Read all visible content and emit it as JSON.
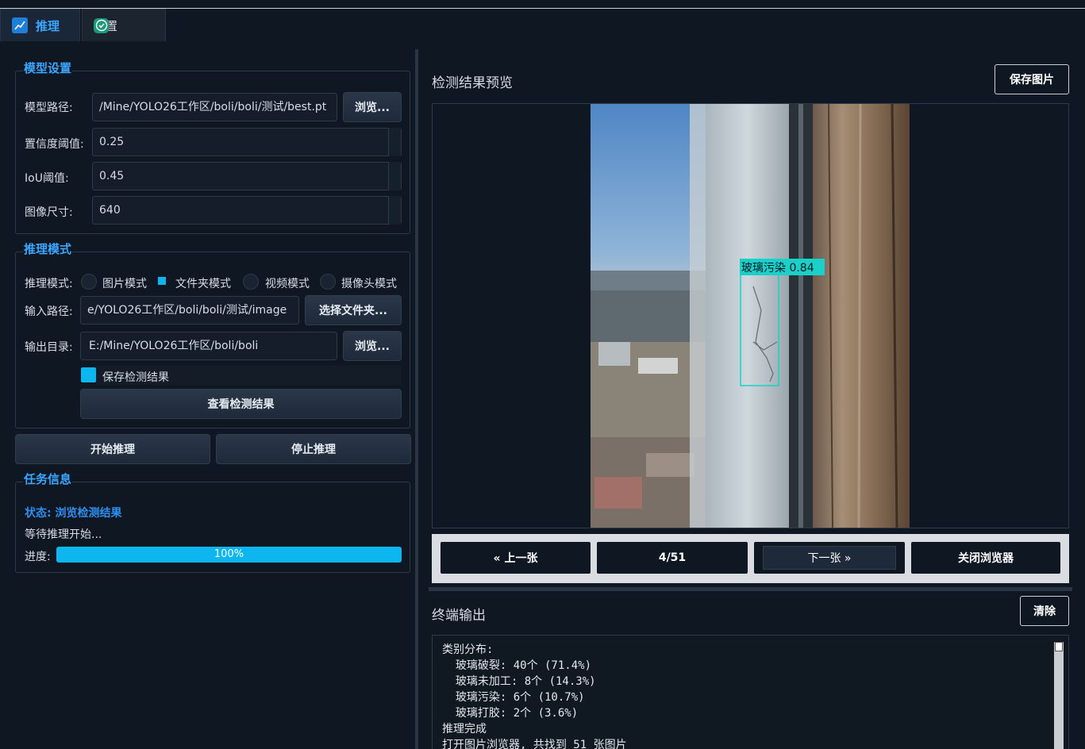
{
  "tabs": [
    {
      "label": "推理",
      "icon": "chart-icon"
    },
    {
      "label": "设置",
      "icon": "check-badge-icon"
    }
  ],
  "model_group": {
    "title": "模型设置",
    "path_label": "模型路径:",
    "path_value": "/Mine/YOLO26工作区/boli/boli/测试/best.pt",
    "browse": "浏览...",
    "conf_label": "置信度阈值:",
    "conf_value": "0.25",
    "iou_label": "IoU阈值:",
    "iou_value": "0.45",
    "size_label": "图像尺寸:",
    "size_value": "640"
  },
  "mode_group": {
    "title": "推理模式",
    "mode_label": "推理模式:",
    "modes": [
      "图片模式",
      "文件夹模式",
      "视频模式",
      "摄像头模式"
    ],
    "selected_mode": "文件夹模式",
    "input_label": "输入路径:",
    "input_value": "e/YOLO26工作区/boli/boli/测试/image",
    "select_folder": "选择文件夹...",
    "output_label": "输出目录:",
    "output_value": "E:/Mine/YOLO26工作区/boli/boli",
    "browse": "浏览...",
    "save_results": "保存检测结果",
    "save_checked": true,
    "view_results": "查看检测结果"
  },
  "actions": {
    "start": "开始推理",
    "stop": "停止推理"
  },
  "task_group": {
    "title": "任务信息",
    "status": "状态: 浏览检测结果",
    "message": "等待推理开始...",
    "progress_label": "进度:",
    "progress_text": "100%",
    "progress": 1.0
  },
  "preview": {
    "title": "检测结果预览",
    "save_image": "保存图片",
    "detection_label": "玻璃污染 0.84",
    "prev": "« 上一张",
    "counter": "4/51",
    "next": "下一张 »",
    "close": "关闭浏览器"
  },
  "terminal": {
    "title": "终端输出",
    "clear": "清除",
    "lines": [
      "类别分布:",
      "  玻璃破裂: 40个 (71.4%)",
      "  玻璃未加工: 8个 (14.3%)",
      "  玻璃污染: 6个 (10.7%)",
      "  玻璃打胶: 2个 (3.6%)",
      "推理完成",
      "打开图片浏览器, 共找到 51 张图片"
    ]
  },
  "colors": {
    "accent": "#3aa6ff",
    "progress": "#0eb6f0",
    "detection": "#19d1c8"
  }
}
